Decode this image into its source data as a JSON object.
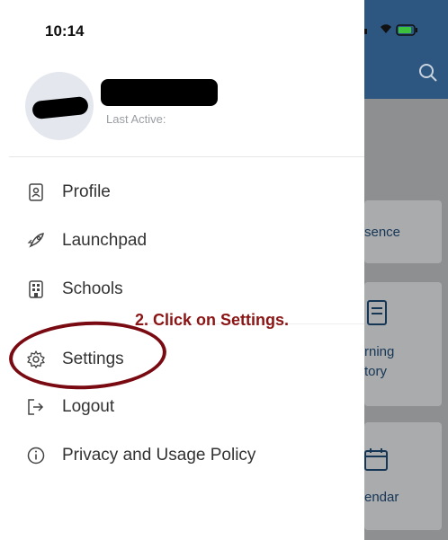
{
  "status_bar": {
    "time": "10:14"
  },
  "profile": {
    "last_active_label": "Last Active:"
  },
  "menu": [
    {
      "label": "Profile",
      "icon": "profile-icon"
    },
    {
      "label": "Launchpad",
      "icon": "rocket-icon"
    },
    {
      "label": "Schools",
      "icon": "building-icon"
    },
    {
      "label": "Settings",
      "icon": "gear-icon"
    },
    {
      "label": "Logout",
      "icon": "logout-icon"
    },
    {
      "label": "Privacy and Usage Policy",
      "icon": "info-icon"
    }
  ],
  "annotation": {
    "text": "2.  Click on Settings."
  },
  "background_app": {
    "cards": [
      {
        "label": "sence"
      },
      {
        "label_line1": "rning",
        "label_line2": "tory"
      },
      {
        "label": "endar"
      }
    ]
  },
  "colors": {
    "header": "#2d5680",
    "annotation": "#8b1414",
    "overlay": "#8d8f91"
  }
}
